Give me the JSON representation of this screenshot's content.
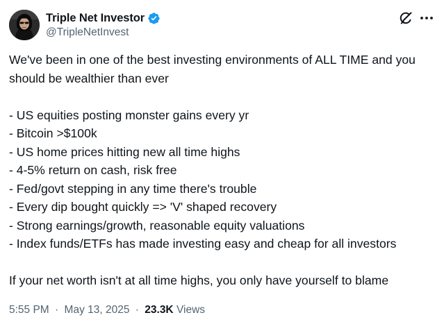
{
  "author": {
    "display_name": "Triple Net Investor",
    "handle": "@TripleNetInvest",
    "verified": true,
    "avatar_icon": "avatar-photo",
    "badge_color": "#1d9bf0"
  },
  "header_icons": {
    "grok": "grok-icon",
    "more": "more-icon"
  },
  "tweet": {
    "intro": "We've been in one of the best investing environments of ALL TIME and you should be wealthier than ever",
    "items": [
      "- US equities posting monster gains every yr",
      "- Bitcoin >$100k",
      "- US home prices hitting new all time highs",
      "- 4-5% return on cash, risk free",
      "- Fed/govt stepping in any time there's trouble",
      "- Every dip bought quickly => 'V' shaped recovery",
      "- Strong earnings/growth, reasonable equity valuations",
      "- Index funds/ETFs has made investing easy and cheap for all investors"
    ],
    "closing": "If your net worth isn't at all time highs, you only have yourself to blame"
  },
  "meta": {
    "time": "5:55 PM",
    "separator": "·",
    "date": "May 13, 2025",
    "views_count": "23.3K",
    "views_label": "Views"
  }
}
